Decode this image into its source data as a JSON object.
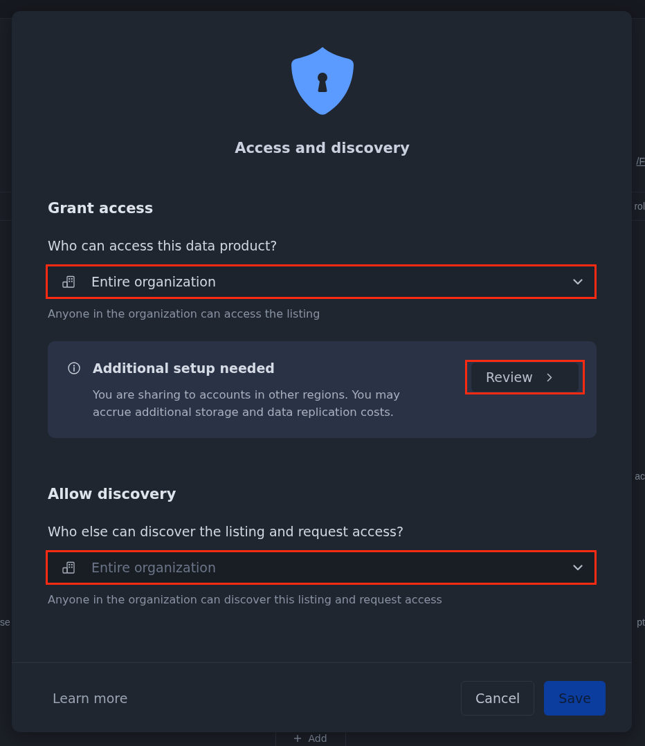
{
  "background": {
    "rows": [
      {
        "right": {
          "text": "/F",
          "kind": "link"
        }
      },
      {
        "right": {
          "text": "rol",
          "kind": "text"
        }
      },
      {
        "right": {
          "text": "ac",
          "kind": "text"
        }
      },
      {
        "left": {
          "text": "se",
          "kind": "text"
        },
        "right": {
          "text": "pt",
          "kind": "text"
        }
      }
    ],
    "add_button": {
      "label": "Add"
    }
  },
  "dialog": {
    "title": "Access and discovery",
    "sections": [
      {
        "heading": "Grant access",
        "question": "Who can access this data product?",
        "select": {
          "value": "Entire organization",
          "disabled": false,
          "highlighted": true
        },
        "hint": "Anyone in the organization can access the listing",
        "notice": {
          "title": "Additional setup needed",
          "body": "You are sharing to accounts in other regions. You may accrue additional storage and data replication costs.",
          "action": {
            "label": "Review",
            "highlighted": true
          }
        }
      },
      {
        "heading": "Allow discovery",
        "question": "Who else can discover the listing and request access?",
        "select": {
          "value": "Entire organization",
          "disabled": true,
          "highlighted": true
        },
        "hint": "Anyone in the organization can discover this listing and request access"
      }
    ],
    "footer": {
      "link": "Learn more",
      "buttons": [
        {
          "label": "Cancel",
          "kind": "secondary",
          "disabled": false
        },
        {
          "label": "Save",
          "kind": "primary",
          "disabled": true
        }
      ]
    }
  }
}
